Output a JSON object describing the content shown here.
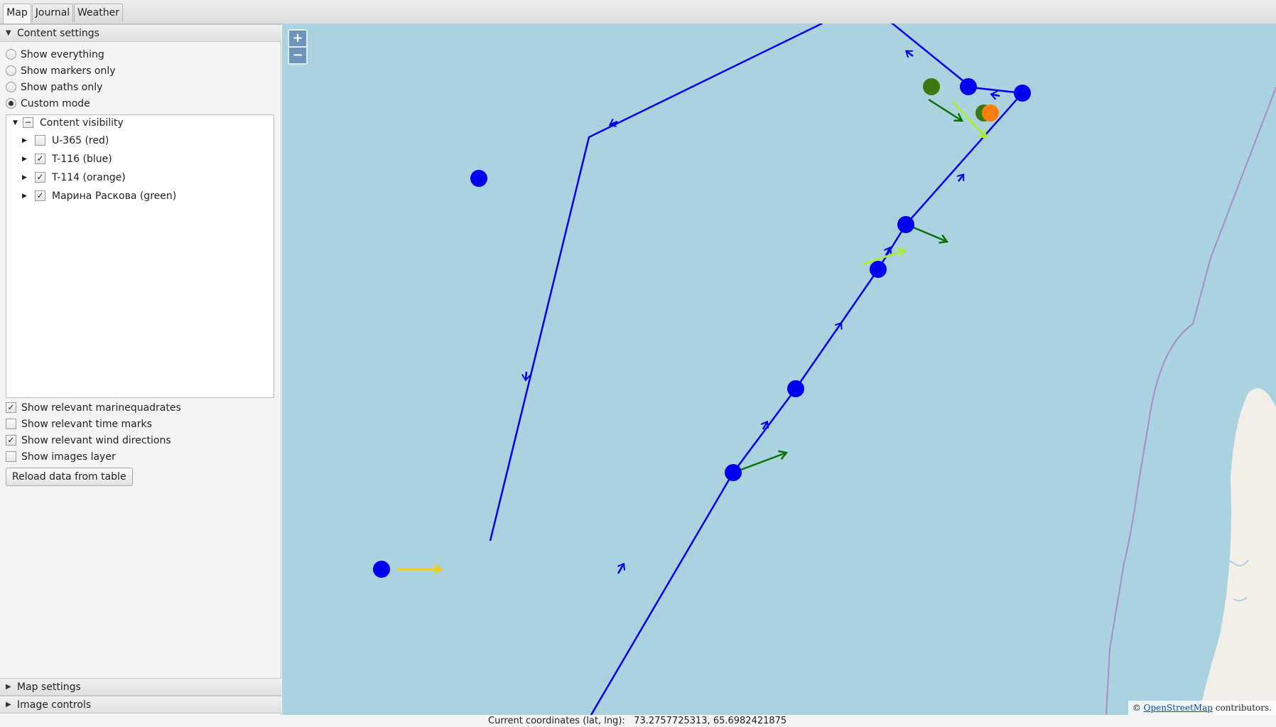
{
  "tabs": [
    {
      "label": "Map",
      "active": true
    },
    {
      "label": "Journal",
      "active": false
    },
    {
      "label": "Weather",
      "active": false
    }
  ],
  "content_settings": {
    "title": "Content settings",
    "modes": [
      {
        "label": "Show everything",
        "selected": false
      },
      {
        "label": "Show markers only",
        "selected": false
      },
      {
        "label": "Show paths only",
        "selected": false
      },
      {
        "label": "Custom mode",
        "selected": true
      }
    ],
    "tree": {
      "root": "Content visibility",
      "root_state": "indeterminate",
      "items": [
        {
          "label": "U-365 (red)",
          "checked": false
        },
        {
          "label": "T-116 (blue)",
          "checked": true
        },
        {
          "label": "T-114 (orange)",
          "checked": true
        },
        {
          "label": "Марина Раскова (green)",
          "checked": true
        }
      ]
    },
    "options": [
      {
        "label": "Show relevant marinequadrates",
        "checked": true
      },
      {
        "label": "Show relevant time marks",
        "checked": false
      },
      {
        "label": "Show relevant wind directions",
        "checked": true
      },
      {
        "label": "Show images layer",
        "checked": false
      }
    ],
    "reload_button": "Reload data from table"
  },
  "map_settings_title": "Map settings",
  "image_controls_title": "Image controls",
  "zoom": {
    "in": "+",
    "out": "−"
  },
  "attribution": {
    "prefix": "©",
    "link": "OpenStreetMap",
    "suffix": "contributors."
  },
  "status": {
    "label": "Current coordinates (lat, lng):",
    "value": "73.2757725313, 65.6982421875"
  },
  "colors": {
    "sea": "#aad3df",
    "land": "#f2efe9",
    "path_blue": "#0000ee",
    "wind_yellow": "#f5d000",
    "wind_lime": "#a8f020",
    "wind_green": "#0a6e0a",
    "marker_green": "#3c7a10",
    "marker_orange": "#ff7f0e",
    "boundary": "#a48fc8"
  },
  "icons": {
    "expanded": "triangle-down-icon",
    "collapsed": "triangle-right-icon",
    "check": "check-icon",
    "indeterminate": "dash-icon"
  }
}
